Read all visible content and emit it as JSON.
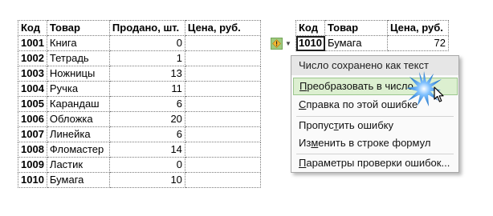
{
  "left_table": {
    "headers": [
      "Код",
      "Товар",
      "Продано, шт.",
      "Цена, руб."
    ],
    "rows": [
      {
        "code": "1001",
        "product": "Книга",
        "sold": "0",
        "price": ""
      },
      {
        "code": "1002",
        "product": "Тетрадь",
        "sold": "1",
        "price": ""
      },
      {
        "code": "1003",
        "product": "Ножницы",
        "sold": "13",
        "price": ""
      },
      {
        "code": "1004",
        "product": "Ручка",
        "sold": "11",
        "price": ""
      },
      {
        "code": "1005",
        "product": "Карандаш",
        "sold": "6",
        "price": ""
      },
      {
        "code": "1006",
        "product": "Обложка",
        "sold": "20",
        "price": ""
      },
      {
        "code": "1007",
        "product": "Линейка",
        "sold": "6",
        "price": ""
      },
      {
        "code": "1008",
        "product": "Фломастер",
        "sold": "14",
        "price": ""
      },
      {
        "code": "1009",
        "product": "Ластик",
        "sold": "0",
        "price": ""
      },
      {
        "code": "1010",
        "product": "Бумага",
        "sold": "10",
        "price": ""
      }
    ]
  },
  "right_table": {
    "headers": [
      "Код",
      "Товар",
      "Цена, руб."
    ],
    "row": {
      "code": "1010",
      "product": "Бумага",
      "price": "72"
    }
  },
  "error_menu": {
    "title": "Число сохранено как текст",
    "items": [
      {
        "pre": "",
        "accel": "П",
        "post": "реобразовать в число"
      },
      {
        "pre": "",
        "accel": "С",
        "post": "правка по этой ошибке"
      },
      {
        "pre": "Пропус",
        "accel": "т",
        "post": "ить ошибку"
      },
      {
        "pre": "Из",
        "accel": "м",
        "post": "енить в строке формул"
      },
      {
        "pre": "",
        "accel": "П",
        "post": "араметры проверки ошибок..."
      }
    ]
  },
  "icons": {
    "error_indicator": "warning-exclamation-icon",
    "dropdown": "chevron-down-icon",
    "pointer": "mouse-cursor-icon",
    "click_effect": "starburst-icon"
  },
  "colors": {
    "error_green": "#9fca7e",
    "highlight_bg": "#dcefd0",
    "starburst_blue": "#1a6fc4"
  }
}
